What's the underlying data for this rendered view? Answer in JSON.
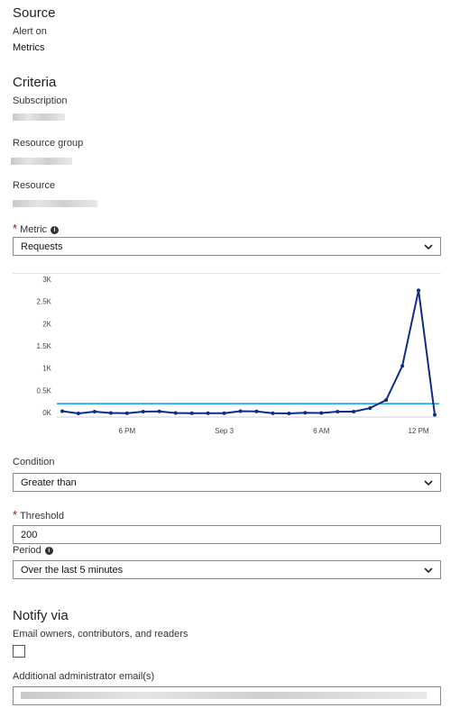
{
  "source": {
    "title": "Source",
    "alert_on_label": "Alert on",
    "alert_on_value": "Metrics"
  },
  "criteria": {
    "title": "Criteria",
    "subscription_label": "Subscription",
    "resource_group_label": "Resource group",
    "resource_label": "Resource",
    "required_mark": "*",
    "metric_label": "Metric",
    "metric_value": "Requests",
    "condition_label": "Condition",
    "condition_value": "Greater than",
    "threshold_label": "Threshold",
    "threshold_value": "200",
    "period_label": "Period",
    "period_value": "Over the last 5 minutes"
  },
  "notify": {
    "title": "Notify via",
    "email_owners_label": "Email owners, contributors, and readers",
    "email_owners_checked": false,
    "admin_email_label": "Additional administrator email(s)"
  },
  "icons": {
    "info": "info-icon",
    "dropdown": "chevron-down-icon"
  },
  "colors": {
    "series": "#0d2b8c",
    "threshold": "#00a2e8"
  },
  "chart_data": {
    "type": "line",
    "y_ticks": [
      "3K",
      "2.5K",
      "2K",
      "1.5K",
      "1K",
      "0.5K",
      "0K"
    ],
    "x_ticks": [
      {
        "label": "6 PM",
        "i": 4
      },
      {
        "label": "Sep 3",
        "i": 10
      },
      {
        "label": "6 AM",
        "i": 16
      },
      {
        "label": "12 PM",
        "i": 22
      }
    ],
    "ylim": [
      0,
      3000
    ],
    "values": [
      30,
      -20,
      20,
      -10,
      -15,
      20,
      25,
      -10,
      -15,
      -15,
      -15,
      30,
      25,
      -15,
      -20,
      -5,
      -10,
      20,
      20,
      100,
      280,
      1050,
      2750,
      -50
    ],
    "threshold": 200
  }
}
